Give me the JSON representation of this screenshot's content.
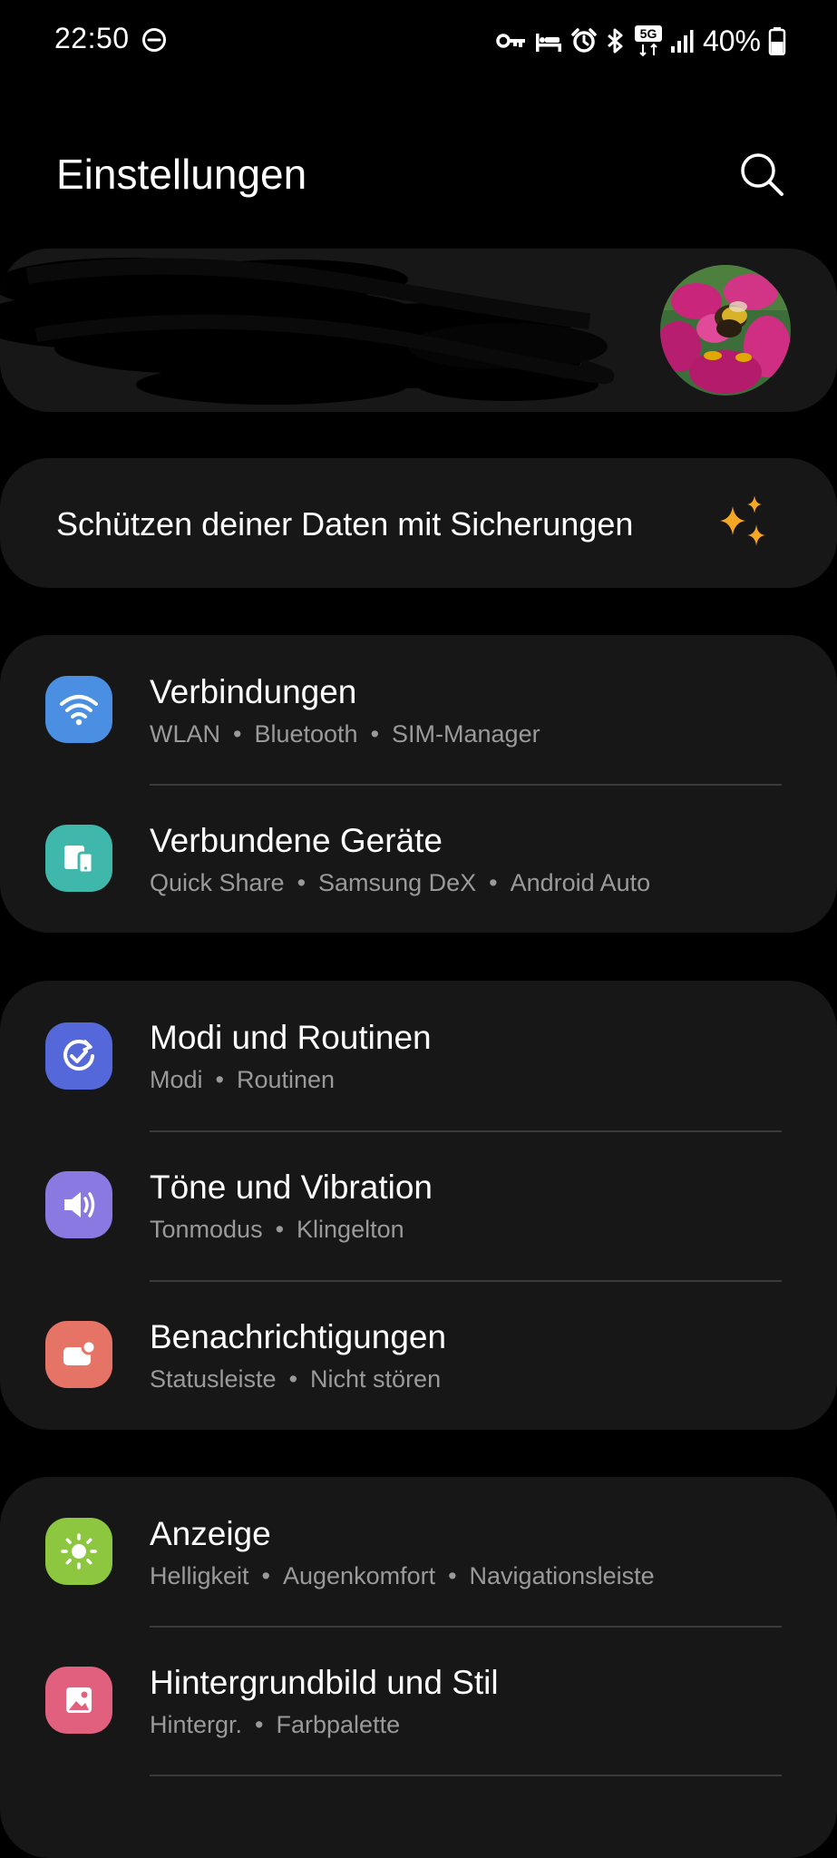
{
  "status_bar": {
    "time": "22:50",
    "battery": "40%",
    "icons": [
      "dnd-icon",
      "vpn-key-icon",
      "sleep-icon",
      "alarm-icon",
      "bluetooth-icon",
      "5g-icon",
      "signal-icon",
      "battery-icon"
    ],
    "network_label": "5G"
  },
  "header": {
    "title": "Einstellungen",
    "search_icon": "search-icon"
  },
  "account": {
    "avatar": "avatar-photo"
  },
  "backup": {
    "label": "Schützen deiner Daten mit Sicherungen",
    "icon": "sparkle-icon",
    "icon_color": "#f5a623"
  },
  "groups": [
    {
      "items": [
        {
          "title": "Verbindungen",
          "subtitle": [
            "WLAN",
            "Bluetooth",
            "SIM-Manager"
          ],
          "icon": "wifi-icon",
          "color": "#4a8fe2"
        },
        {
          "title": "Verbundene Geräte",
          "subtitle": [
            "Quick Share",
            "Samsung DeX",
            "Android Auto"
          ],
          "icon": "connected-devices-icon",
          "color": "#3fb8ab"
        }
      ]
    },
    {
      "items": [
        {
          "title": "Modi und Routinen",
          "subtitle": [
            "Modi",
            "Routinen"
          ],
          "icon": "modes-routines-icon",
          "color": "#5468d9"
        },
        {
          "title": "Töne und Vibration",
          "subtitle": [
            "Tonmodus",
            "Klingelton"
          ],
          "icon": "sound-icon",
          "color": "#8a79e0"
        },
        {
          "title": "Benachrichtigungen",
          "subtitle": [
            "Statusleiste",
            "Nicht stören"
          ],
          "icon": "notifications-icon",
          "color": "#e57466"
        }
      ]
    },
    {
      "items": [
        {
          "title": "Anzeige",
          "subtitle": [
            "Helligkeit",
            "Augenkomfort",
            "Navigationsleiste"
          ],
          "icon": "display-icon",
          "color": "#8dc63f"
        },
        {
          "title": "Hintergrundbild und Stil",
          "subtitle": [
            "Hintergr.",
            "Farbpalette"
          ],
          "icon": "wallpaper-icon",
          "color": "#e0607e"
        }
      ]
    }
  ]
}
